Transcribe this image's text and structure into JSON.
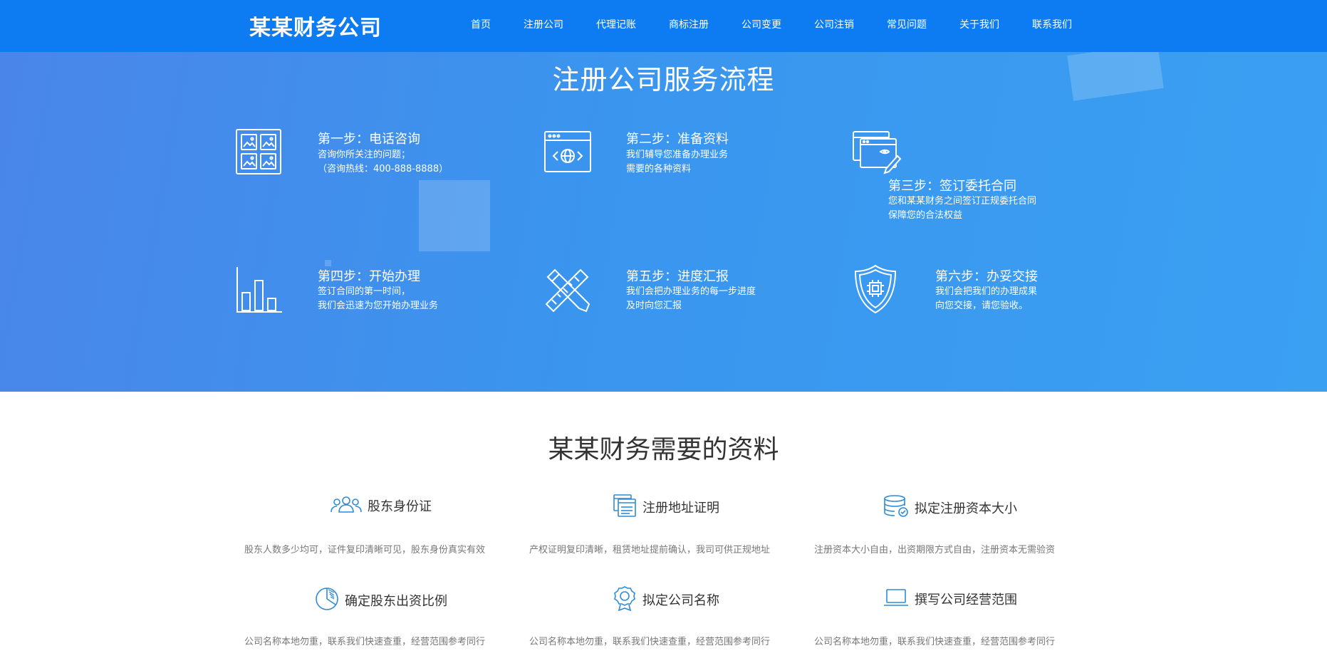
{
  "header": {
    "logo": "某某财务公司",
    "nav": [
      "首页",
      "注册公司",
      "代理记账",
      "商标注册",
      "公司变更",
      "公司注销",
      "常见问题",
      "关于我们",
      "联系我们"
    ]
  },
  "process": {
    "title": "注册公司服务流程",
    "steps": [
      {
        "title": "第一步：电话咨询",
        "lines": [
          "咨询你所关注的问题；",
          "（咨询热线：400-888-8888）"
        ],
        "icon": "image-grid-icon"
      },
      {
        "title": "第二步：准备资料",
        "lines": [
          "我们辅导您准备办理业务",
          "需要的各种资料"
        ],
        "icon": "browser-globe-icon"
      },
      {
        "title": "第三步：签订委托合同",
        "lines": [
          "您和某某财务之间签订正规委托合同",
          "保障您的合法权益"
        ],
        "icon": "windows-pen-icon"
      },
      {
        "title": "第四步：开始办理",
        "lines": [
          "签订合同的第一时间，",
          "我们会迅速为您开始办理业务"
        ],
        "icon": "bar-chart-icon"
      },
      {
        "title": "第五步：进度汇报",
        "lines": [
          "我们会把办理业务的每一步进度",
          "及时向您汇报"
        ],
        "icon": "ruler-pencil-icon"
      },
      {
        "title": "第六步：办妥交接",
        "lines": [
          "我们会把我们的办理成果",
          "向您交接，请您验收。"
        ],
        "icon": "shield-chip-icon"
      }
    ]
  },
  "materials": {
    "title": "某某财务需要的资料",
    "items": [
      {
        "label": "股东身份证",
        "desc": "股东人数多少均可，证件复印清晰可见，股东身份真实有效",
        "icon": "people-icon"
      },
      {
        "label": "注册地址证明",
        "desc": "产权证明复印清晰，租赁地址提前确认，我司可供正规地址",
        "icon": "documents-icon"
      },
      {
        "label": "拟定注册资本大小",
        "desc": "注册资本大小自由，出资期限方式自由，注册资本无需验资",
        "icon": "database-check-icon"
      },
      {
        "label": "确定股东出资比例",
        "desc": "公司名称本地勿重，联系我们快速查重，经营范围参考同行",
        "icon": "pie-chart-icon"
      },
      {
        "label": "拟定公司名称",
        "desc": "公司名称本地勿重，联系我们快速查重，经营范围参考同行",
        "icon": "award-badge-icon"
      },
      {
        "label": "撰写公司经营范围",
        "desc": "公司名称本地勿重，联系我们快速查重，经营范围参考同行",
        "icon": "laptop-icon"
      }
    ]
  },
  "colors": {
    "header": "#0d7cf2",
    "hero": "#3a95ee",
    "icon_accent": "#2f8bd6"
  }
}
